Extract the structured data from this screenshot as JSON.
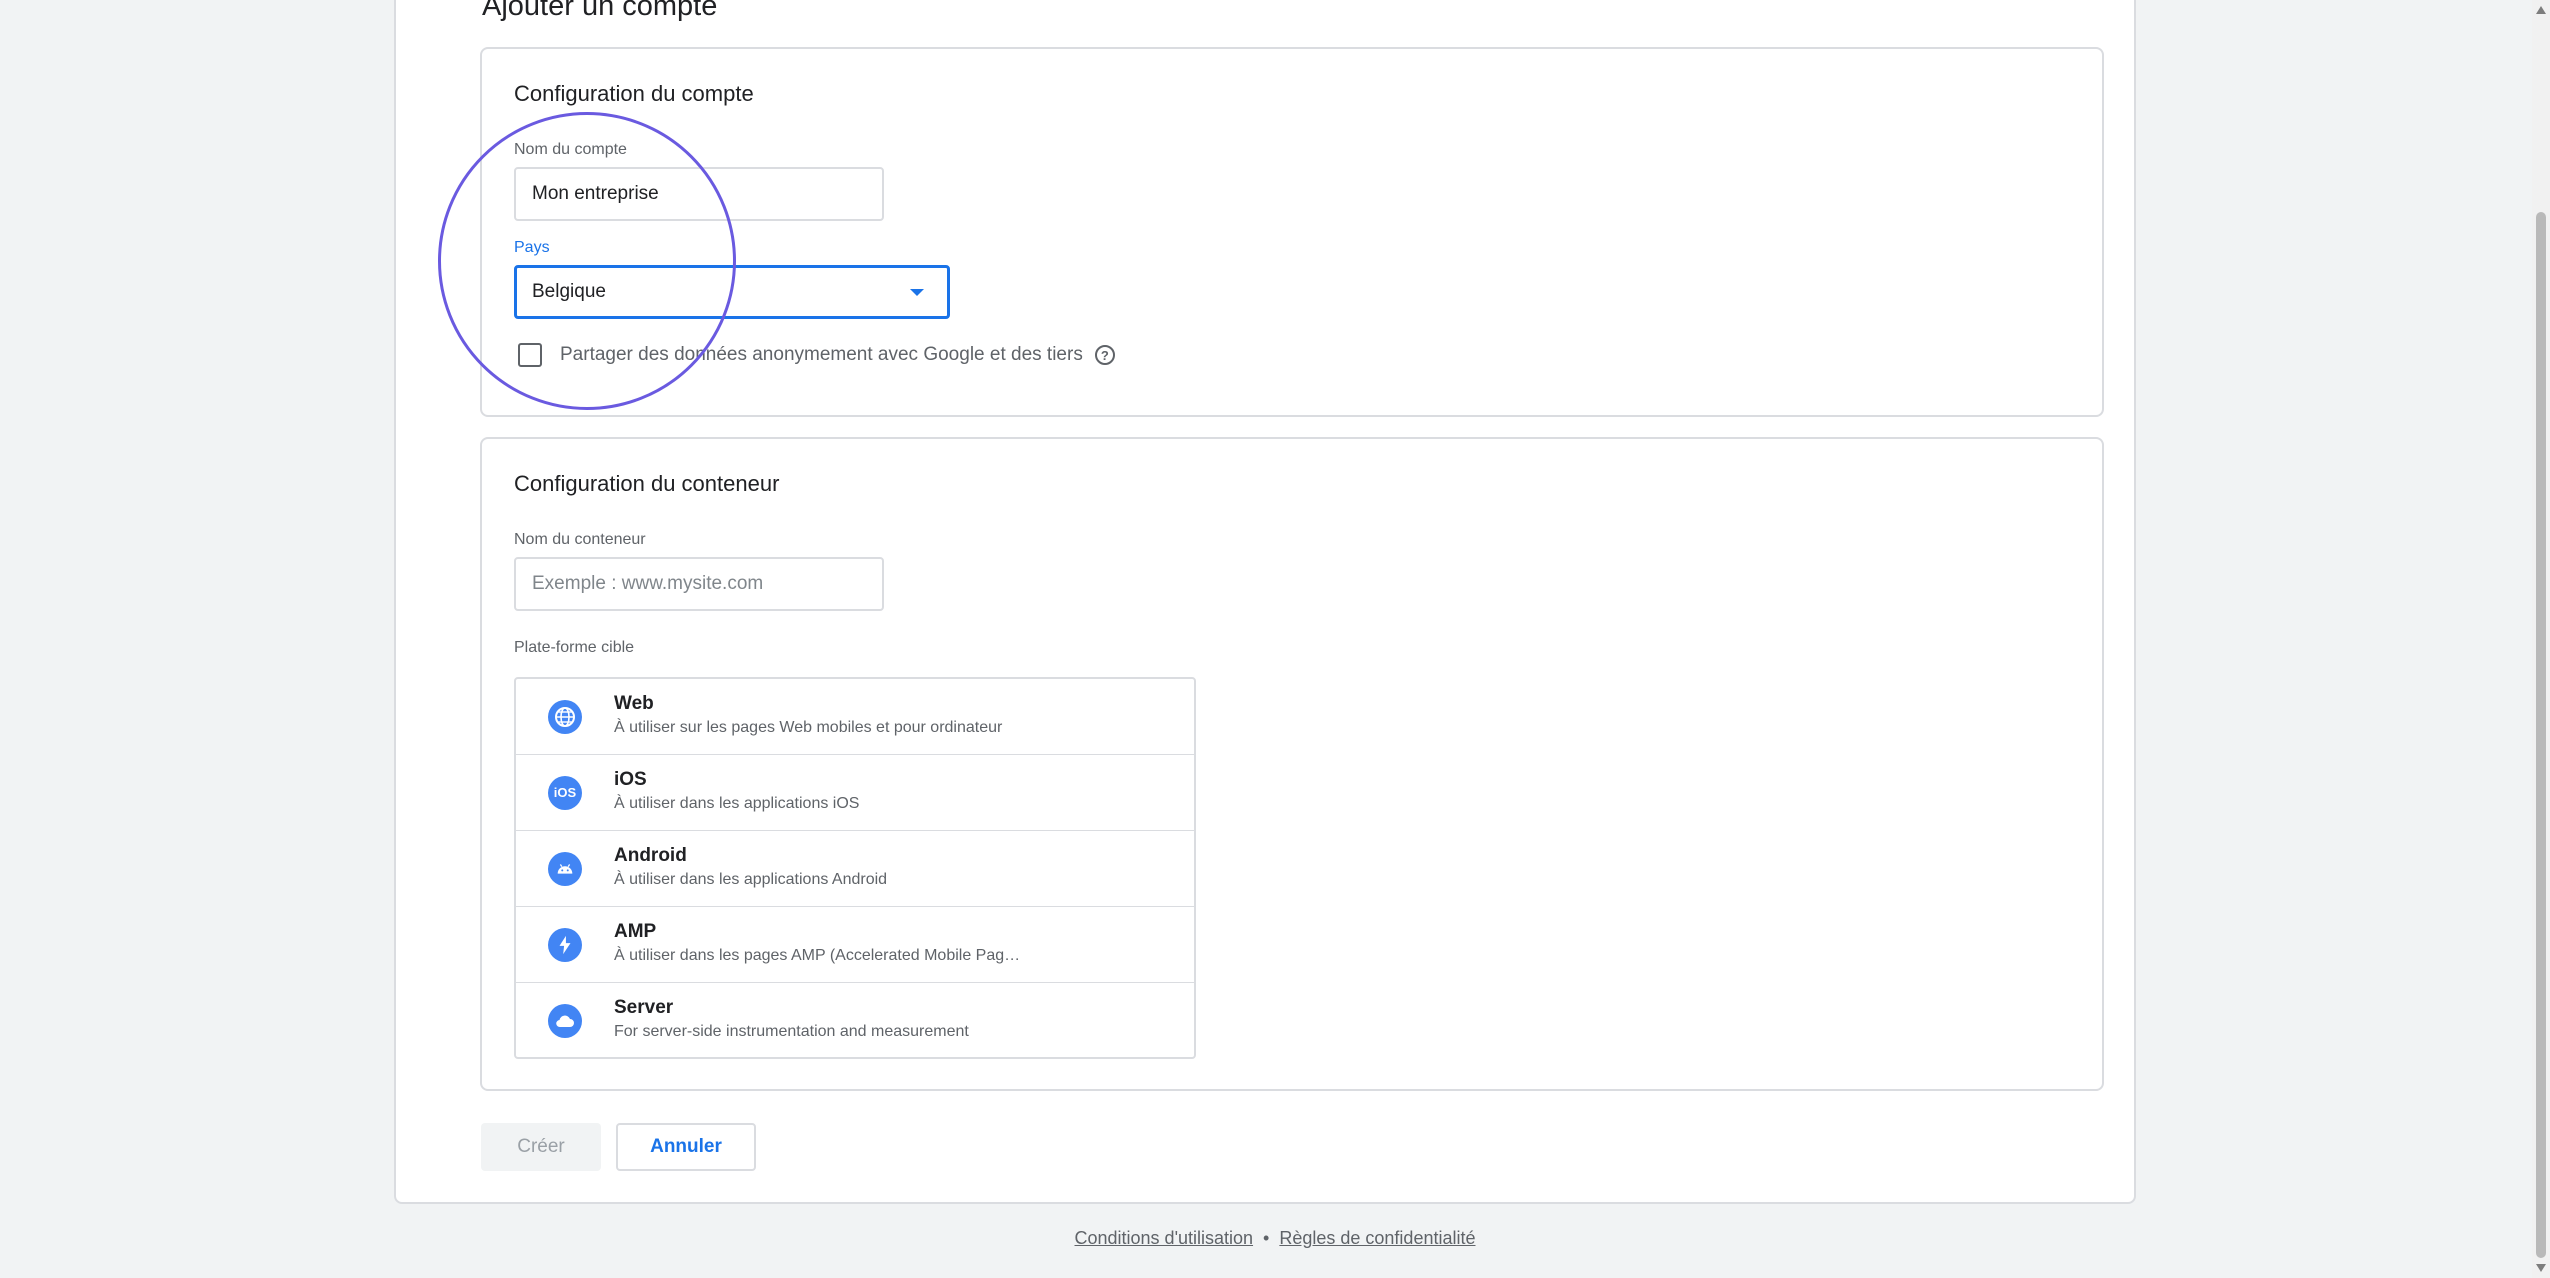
{
  "page": {
    "title": "Ajouter un compte"
  },
  "account": {
    "section_title": "Configuration du compte",
    "name_label": "Nom du compte",
    "name_value": "Mon entreprise",
    "country_label": "Pays",
    "country_value": "Belgique",
    "share_data_label": "Partager des données anonymement avec Google et des tiers",
    "share_data_checked": false,
    "help_icon": "help-circle-icon"
  },
  "container": {
    "section_title": "Configuration du conteneur",
    "name_label": "Nom du conteneur",
    "name_placeholder": "Exemple : www.mysite.com",
    "platform_label": "Plate-forme cible",
    "platforms": [
      {
        "name": "Web",
        "desc": "À utiliser sur les pages Web mobiles et pour ordinateur",
        "icon": "globe-icon"
      },
      {
        "name": "iOS",
        "desc": "À utiliser dans les applications iOS",
        "icon": "ios-icon"
      },
      {
        "name": "Android",
        "desc": "À utiliser dans les applications Android",
        "icon": "android-icon"
      },
      {
        "name": "AMP",
        "desc": "À utiliser dans les pages AMP (Accelerated Mobile Pag…",
        "icon": "lightning-icon"
      },
      {
        "name": "Server",
        "desc": "For server-side instrumentation and measurement",
        "icon": "cloud-icon"
      }
    ]
  },
  "buttons": {
    "create": "Créer",
    "cancel": "Annuler"
  },
  "footer": {
    "terms": "Conditions d'utilisation",
    "separator": "•",
    "privacy": "Règles de confidentialité"
  },
  "colors": {
    "accent": "#1a73e8",
    "platform_icon": "#4285f4",
    "annotation": "#6a5ae0"
  }
}
